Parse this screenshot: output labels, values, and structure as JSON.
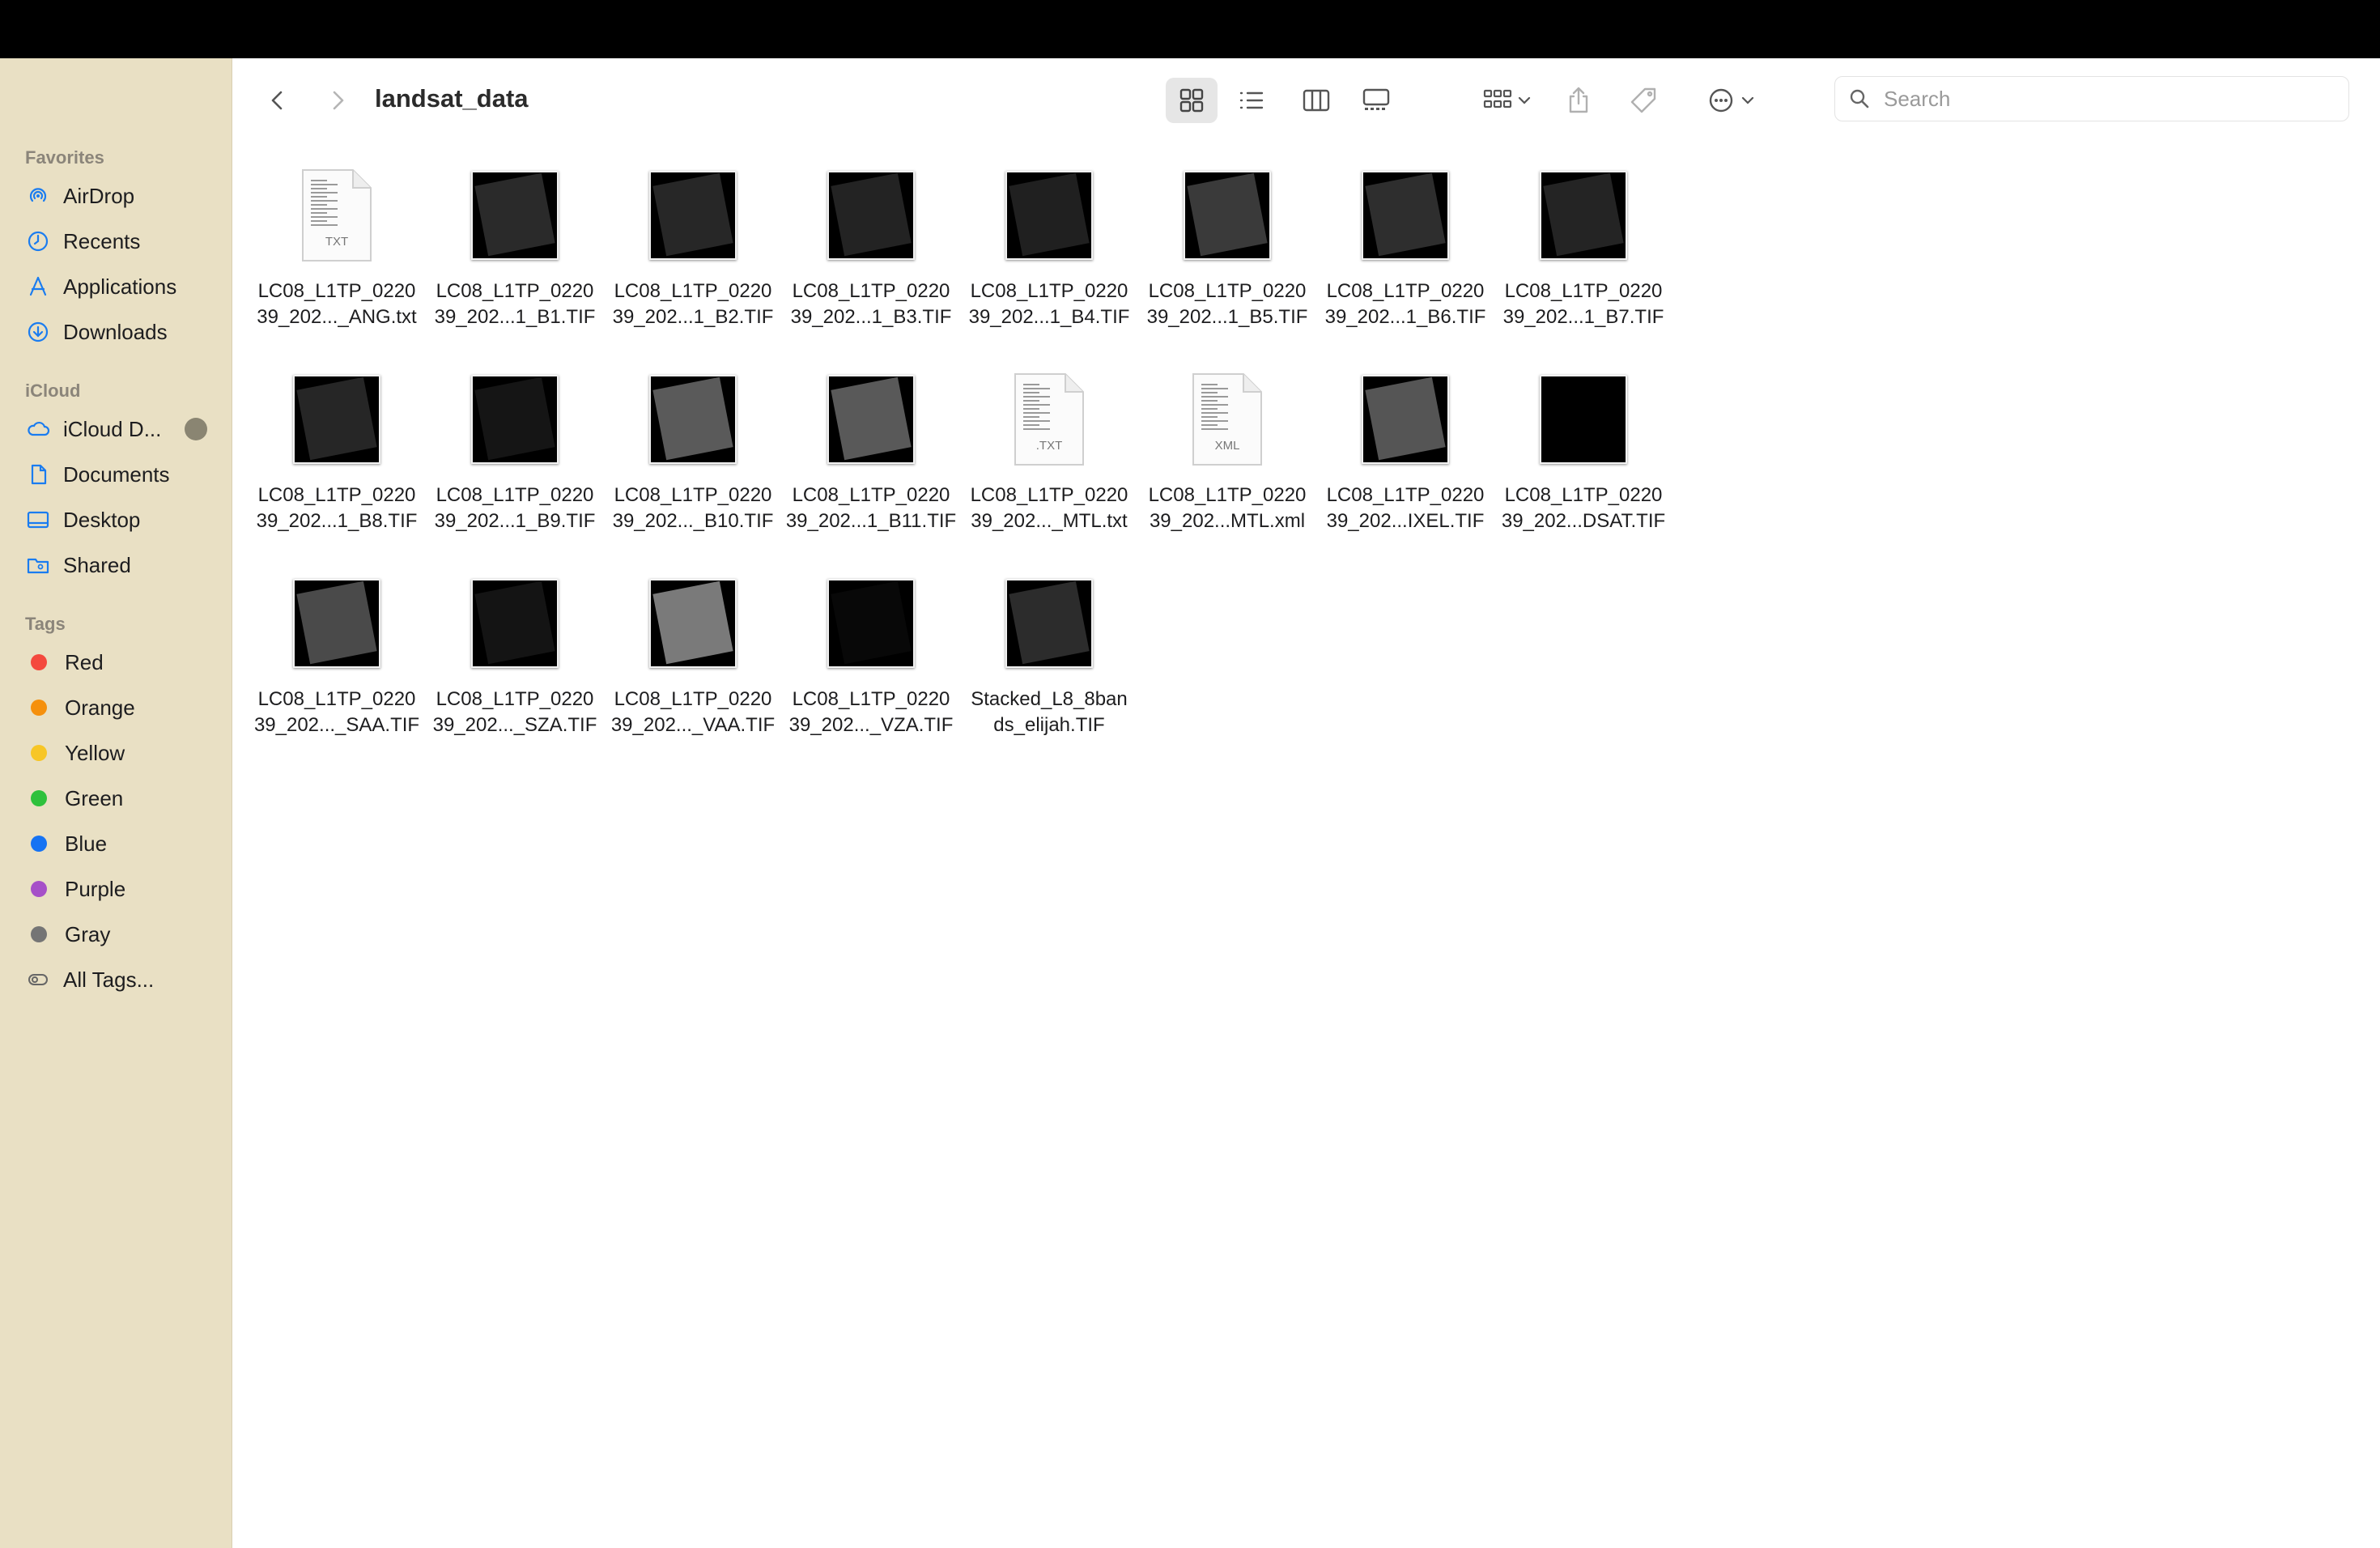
{
  "toolbar": {
    "title": "landsat_data",
    "search_placeholder": "Search",
    "icons": [
      "chevron-left-icon",
      "chevron-right-icon",
      "icon-view-icon",
      "list-view-icon",
      "column-view-icon",
      "gallery-view-icon",
      "group-icon",
      "share-icon",
      "tag-icon",
      "more-icon"
    ]
  },
  "sidebar": {
    "favorites_header": "Favorites",
    "favorites": [
      {
        "label": "AirDrop",
        "icon": "airdrop-icon"
      },
      {
        "label": "Recents",
        "icon": "clock-icon"
      },
      {
        "label": "Applications",
        "icon": "applications-icon"
      },
      {
        "label": "Downloads",
        "icon": "download-icon"
      }
    ],
    "icloud_header": "iCloud",
    "icloud": [
      {
        "label": "iCloud D...",
        "icon": "cloud-icon"
      },
      {
        "label": "Documents",
        "icon": "document-icon"
      },
      {
        "label": "Desktop",
        "icon": "desktop-icon"
      },
      {
        "label": "Shared",
        "icon": "shared-folder-icon"
      }
    ],
    "tags_header": "Tags",
    "tags": [
      {
        "label": "Red",
        "color": "#f4493e"
      },
      {
        "label": "Orange",
        "color": "#f5900d"
      },
      {
        "label": "Yellow",
        "color": "#f7c626"
      },
      {
        "label": "Green",
        "color": "#2ec13c"
      },
      {
        "label": "Blue",
        "color": "#1673f3"
      },
      {
        "label": "Purple",
        "color": "#a650c8"
      },
      {
        "label": "Gray",
        "color": "#757575"
      },
      {
        "label": "All Tags...",
        "color": ""
      }
    ]
  },
  "files": [
    {
      "line1": "LC08_L1TP_0220",
      "line2": "39_202..._ANG.txt",
      "kind": "doc",
      "ext": "TXT"
    },
    {
      "line1": "LC08_L1TP_0220",
      "line2": "39_202...1_B1.TIF",
      "kind": "image",
      "tone": "#2a2a2a"
    },
    {
      "line1": "LC08_L1TP_0220",
      "line2": "39_202...1_B2.TIF",
      "kind": "image",
      "tone": "#272727"
    },
    {
      "line1": "LC08_L1TP_0220",
      "line2": "39_202...1_B3.TIF",
      "kind": "image",
      "tone": "#232323"
    },
    {
      "line1": "LC08_L1TP_0220",
      "line2": "39_202...1_B4.TIF",
      "kind": "image",
      "tone": "#202020"
    },
    {
      "line1": "LC08_L1TP_0220",
      "line2": "39_202...1_B5.TIF",
      "kind": "image",
      "tone": "#3a3a3a"
    },
    {
      "line1": "LC08_L1TP_0220",
      "line2": "39_202...1_B6.TIF",
      "kind": "image",
      "tone": "#2e2e2e"
    },
    {
      "line1": "LC08_L1TP_0220",
      "line2": "39_202...1_B7.TIF",
      "kind": "image",
      "tone": "#242424"
    },
    {
      "line1": "LC08_L1TP_0220",
      "line2": "39_202...1_B8.TIF",
      "kind": "image",
      "tone": "#262626"
    },
    {
      "line1": "LC08_L1TP_0220",
      "line2": "39_202...1_B9.TIF",
      "kind": "image",
      "tone": "#151515"
    },
    {
      "line1": "LC08_L1TP_0220",
      "line2": "39_202..._B10.TIF",
      "kind": "image",
      "tone": "#5a5a5a"
    },
    {
      "line1": "LC08_L1TP_0220",
      "line2": "39_202...1_B11.TIF",
      "kind": "image",
      "tone": "#595959"
    },
    {
      "line1": "LC08_L1TP_0220",
      "line2": "39_202..._MTL.txt",
      "kind": "doc",
      "ext": ".TXT"
    },
    {
      "line1": "LC08_L1TP_0220",
      "line2": "39_202...MTL.xml",
      "kind": "doc",
      "ext": "XML"
    },
    {
      "line1": "LC08_L1TP_0220",
      "line2": "39_202...IXEL.TIF",
      "kind": "image",
      "tone": "#555555"
    },
    {
      "line1": "LC08_L1TP_0220",
      "line2": "39_202...DSAT.TIF",
      "kind": "image",
      "tone": "#000000"
    },
    {
      "line1": "LC08_L1TP_0220",
      "line2": "39_202..._SAA.TIF",
      "kind": "image",
      "tone": "#4a4a4a"
    },
    {
      "line1": "LC08_L1TP_0220",
      "line2": "39_202..._SZA.TIF",
      "kind": "image",
      "tone": "#141414"
    },
    {
      "line1": "LC08_L1TP_0220",
      "line2": "39_202..._VAA.TIF",
      "kind": "image",
      "tone": "#7a7a7a"
    },
    {
      "line1": "LC08_L1TP_0220",
      "line2": "39_202..._VZA.TIF",
      "kind": "image",
      "tone": "#080808"
    },
    {
      "line1": "Stacked_L8_8ban",
      "line2": "ds_elijah.TIF",
      "kind": "image",
      "tone": "#2c2c2c"
    }
  ]
}
